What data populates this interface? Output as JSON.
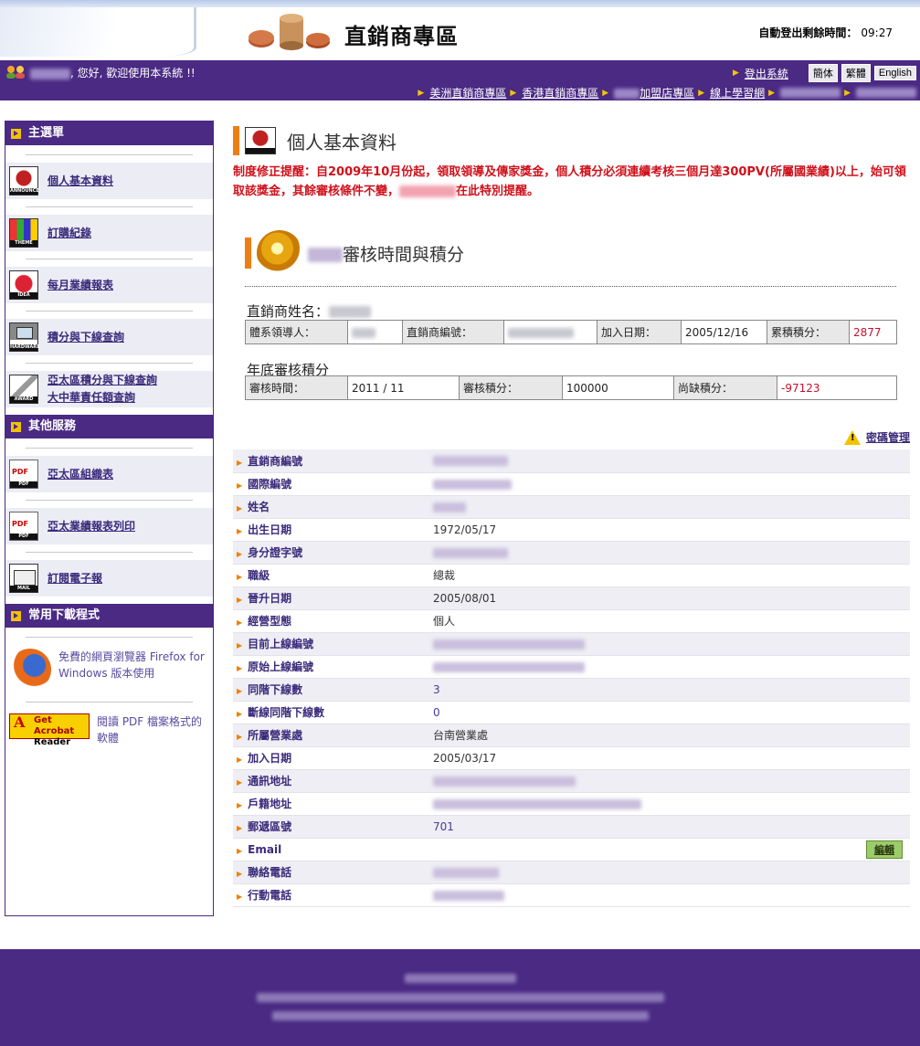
{
  "header": {
    "site_title": "直銷商專區",
    "logout_label": "自動登出剩餘時間：",
    "logout_time": "09:27"
  },
  "topbar": {
    "welcome_suffix": ", 您好, 歡迎使用本系統 !!",
    "logout_link": "登出系統",
    "lang_buttons": [
      "簡体",
      "繁體",
      "English"
    ],
    "quick_links": [
      "美洲直銷商專區",
      "香港直銷商專區",
      "加盟店專區",
      "線上學習網"
    ]
  },
  "sidebar": {
    "main_heading": "主選單",
    "main_items": [
      {
        "label": "個人基本資料",
        "icon": "announce-icon"
      },
      {
        "label": "訂購紀錄",
        "icon": "theme-icon"
      },
      {
        "label": "每月業績報表",
        "icon": "idea-icon"
      },
      {
        "label": "積分與下線查詢",
        "icon": "hardware-icon"
      },
      {
        "label": "亞太區積分與下線查詢",
        "label2": "大中華責任額查詢",
        "icon": "award-icon"
      }
    ],
    "other_heading": "其他服務",
    "other_items": [
      {
        "label": "亞太區組織表",
        "icon": "pdf-icon"
      },
      {
        "label": "亞太業績報表列印",
        "icon": "pdf-icon"
      },
      {
        "label": "訂閱電子報",
        "icon": "mail-icon"
      }
    ],
    "download_heading": "常用下載程式",
    "downloads": [
      {
        "text": "免費的網頁瀏覽器 Firefox for Windows 版本使用",
        "icon": "firefox-icon"
      },
      {
        "text": "閱讀 PDF 檔案格式的軟體",
        "icon": "acrobat-reader-icon",
        "logo_text": "Get Acrobat Reader",
        "logo_brand": "Adobe"
      }
    ]
  },
  "main": {
    "page_title": "個人基本資料",
    "notice_pre": "制度修正提醒：自2009年10月份起，領取領導及傳家獎金，個人積分必須連續考核三個月達300PV(所屬國業績)以上，始可領取該獎金，其餘審核條件不變，",
    "notice_post": "在此特別提醒。",
    "section_title": "審核時間與積分",
    "member_caption": "直銷商姓名：",
    "member_table": {
      "sponsor_label": "體系領導人：",
      "id_label": "直銷商編號：",
      "join_label": "加入日期：",
      "join_value": "2005/12/16",
      "points_label": "累積積分：",
      "points_value": "2877"
    },
    "review_caption": "年底審核積分",
    "review_table": {
      "time_label": "審核時間：",
      "time_value": "2011 / 11",
      "score_label": "審核積分：",
      "score_value": "100000",
      "short_label": "尚缺積分：",
      "short_value": "-97123"
    },
    "password_link": "密碼管理",
    "detail_rows": [
      {
        "label": "直銷商編號",
        "value": null
      },
      {
        "label": "國際編號",
        "value": null
      },
      {
        "label": "姓名",
        "value": null
      },
      {
        "label": "出生日期",
        "value": "1972/05/17"
      },
      {
        "label": "身分證字號",
        "value": null
      },
      {
        "label": "職級",
        "value": "總裁"
      },
      {
        "label": "晉升日期",
        "value": "2005/08/01"
      },
      {
        "label": "經營型態",
        "value": "個人"
      },
      {
        "label": "目前上線編號",
        "value": null
      },
      {
        "label": "原始上線編號",
        "value": null
      },
      {
        "label": "同階下線數",
        "value": "3"
      },
      {
        "label": "斷線同階下線數",
        "value": "0"
      },
      {
        "label": "所屬營業處",
        "value": "台南營業處"
      },
      {
        "label": "加入日期",
        "value": "2005/03/17"
      },
      {
        "label": "通訊地址",
        "value": null
      },
      {
        "label": "戶籍地址",
        "value": null
      },
      {
        "label": "郵遞區號",
        "value": "701"
      },
      {
        "label": "Email",
        "value": null
      },
      {
        "label": "聯絡電話",
        "value": null
      },
      {
        "label": "行動電話",
        "value": null
      }
    ],
    "edit_button": "編輯"
  },
  "colors": {
    "brand_purple": "#4a2a83",
    "accent_orange": "#f07d14",
    "notice_red": "#d0101a"
  }
}
